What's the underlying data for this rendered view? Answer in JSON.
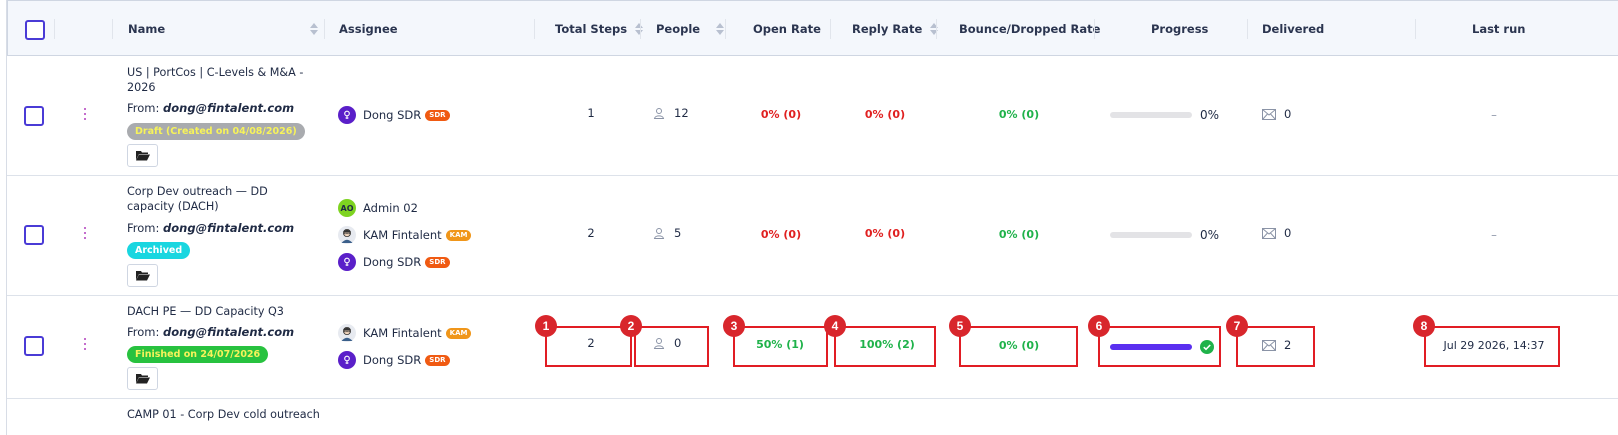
{
  "header": {
    "name": "Name",
    "assignee": "Assignee",
    "total_steps": "Total Steps",
    "people": "People",
    "open_rate": "Open Rate",
    "reply_rate": "Reply Rate",
    "bounce_rate": "Bounce/Dropped Rate",
    "progress": "Progress",
    "delivered": "Delivered",
    "last_run": "Last run"
  },
  "rows": [
    {
      "title": "US | PortCos | C-Levels & M&A - 2026",
      "from_label": "From:",
      "from_email": "dong@fintalent.com",
      "status": "Draft (Created on 04/08/2026)",
      "assignees": [
        {
          "initials": "",
          "name": "Dong SDR",
          "role": "SDR"
        }
      ],
      "steps": "1",
      "people": "12",
      "open_rate": "0% (0)",
      "reply_rate": "0% (0)",
      "bounce_rate": "0% (0)",
      "progress_pct": 0,
      "progress_label": "0%",
      "delivered": "0",
      "last_run": "–"
    },
    {
      "title": "Corp Dev outreach — DD capacity (DACH)",
      "from_label": "From:",
      "from_email": "dong@fintalent.com",
      "status": "Archived",
      "assignees": [
        {
          "initials": "AO",
          "name": "Admin 02",
          "role": ""
        },
        {
          "initials": "",
          "name": "KAM Fintalent",
          "role": "KAM"
        },
        {
          "initials": "",
          "name": "Dong SDR",
          "role": "SDR"
        }
      ],
      "steps": "2",
      "people": "5",
      "open_rate": "0% (0)",
      "reply_rate": "0% (0)",
      "bounce_rate": "0% (0)",
      "progress_pct": 0,
      "progress_label": "0%",
      "delivered": "0",
      "last_run": "–"
    },
    {
      "title": "DACH PE — DD Capacity Q3",
      "from_label": "From:",
      "from_email": "dong@fintalent.com",
      "status": "Finished on 24/07/2026",
      "assignees": [
        {
          "initials": "",
          "name": "KAM Fintalent",
          "role": "KAM"
        },
        {
          "initials": "",
          "name": "Dong SDR",
          "role": "SDR"
        }
      ],
      "steps": "2",
      "people": "0",
      "open_rate": "50% (1)",
      "reply_rate": "100% (2)",
      "bounce_rate": "0% (0)",
      "progress_pct": 100,
      "delivered": "2",
      "last_run": "Jul 29 2026, 14:37"
    },
    {
      "title": "CAMP 01 - Corp Dev cold outreach"
    }
  ],
  "annotations": [
    "1",
    "2",
    "3",
    "4",
    "5",
    "6",
    "7",
    "8"
  ],
  "colors": {
    "accent": "#4a3bd6",
    "progress": "#5a2ff0",
    "danger": "#e02020",
    "success": "#1fb24a",
    "annotation": "#e11d24"
  }
}
